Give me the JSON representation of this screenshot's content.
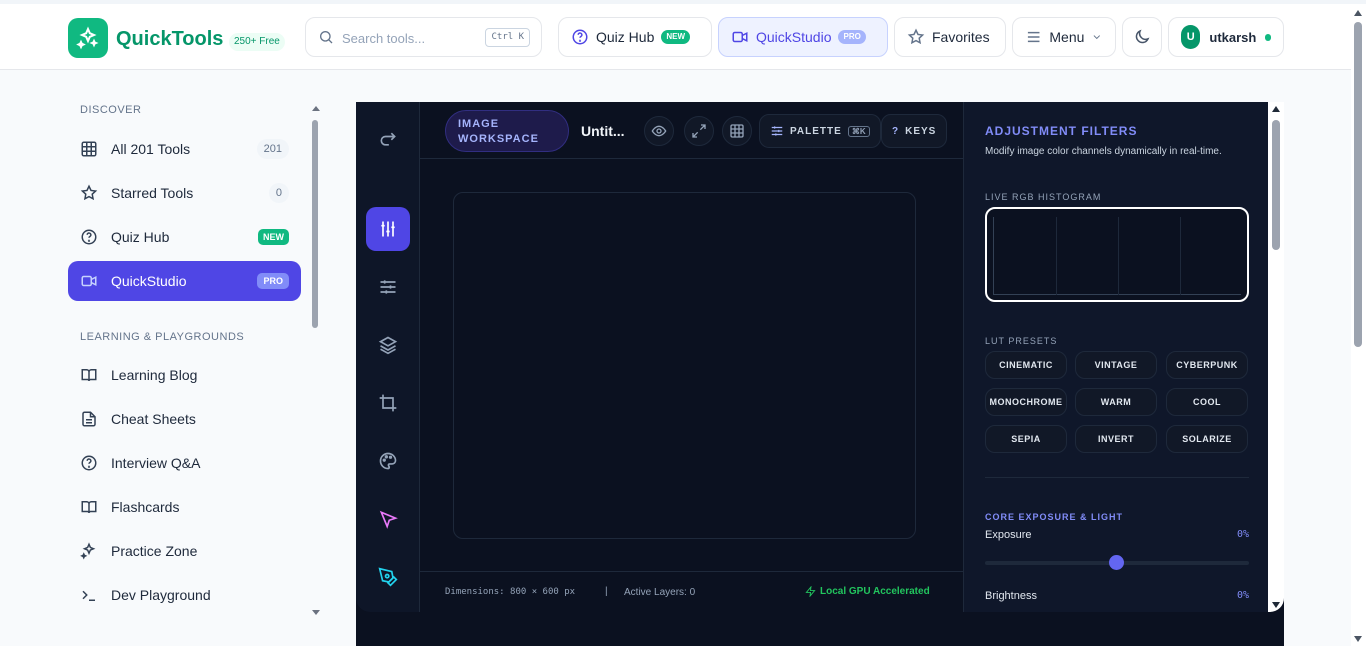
{
  "header": {
    "logo_text": "QuickTools",
    "logo_badge": "250+ Free",
    "search": {
      "placeholder": "Search tools...",
      "shortcut": "Ctrl K"
    },
    "nav": {
      "quiz_hub": {
        "label": "Quiz Hub",
        "badge": "NEW"
      },
      "quick_studio": {
        "label": "QuickStudio",
        "badge": "PRO"
      },
      "favorites": "Favorites",
      "menu": "Menu"
    },
    "user": {
      "initial": "U",
      "name": "utkarsh"
    }
  },
  "sidebar": {
    "discover_title": "DISCOVER",
    "learning_title": "LEARNING & PLAYGROUNDS",
    "items": [
      {
        "label": "All 201 Tools",
        "count": "201"
      },
      {
        "label": "Starred Tools",
        "count": "0"
      },
      {
        "label": "Quiz Hub",
        "badge": "NEW"
      },
      {
        "label": "QuickStudio",
        "badge": "PRO"
      },
      {
        "label": "Learning Blog"
      },
      {
        "label": "Cheat Sheets"
      },
      {
        "label": "Interview Q&A"
      },
      {
        "label": "Flashcards"
      },
      {
        "label": "Practice Zone"
      },
      {
        "label": "Dev Playground"
      }
    ]
  },
  "studio": {
    "workspace_badge_line1": "IMAGE",
    "workspace_badge_line2": "WORKSPACE",
    "doc_title": "Untit...",
    "palette_label": "PALETTE",
    "palette_key": "⌘K",
    "keys_label": "KEYS",
    "keys_icon": "?",
    "status": {
      "dimensions": "Dimensions: 800 × 600 px",
      "separator": "|",
      "layers": "Active Layers: 0",
      "gpu": "Local GPU Accelerated"
    },
    "panel": {
      "title": "ADJUSTMENT FILTERS",
      "subtitle": "Modify image color channels dynamically in real-time.",
      "histogram_label": "LIVE RGB HISTOGRAM",
      "lut_label": "LUT PRESETS",
      "luts": [
        "CINEMATIC",
        "VINTAGE",
        "CYBERPUNK",
        "MONOCHROME",
        "WARM",
        "COOL",
        "SEPIA",
        "INVERT",
        "SOLARIZE"
      ],
      "section_title": "CORE EXPOSURE & LIGHT",
      "exposure": {
        "label": "Exposure",
        "value": "0%"
      },
      "brightness": {
        "label": "Brightness",
        "value": "0%"
      }
    }
  },
  "colors": {
    "brand": "#10b981",
    "accent": "#4f46e5",
    "studio_bg": "#0b1120"
  }
}
